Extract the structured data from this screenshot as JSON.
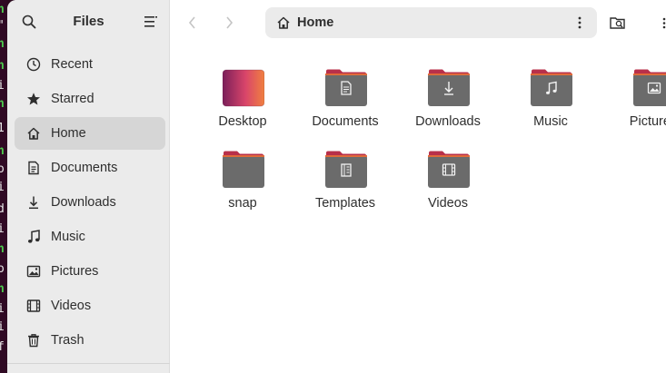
{
  "sidebar": {
    "title": "Files",
    "items": [
      {
        "label": "Recent",
        "icon": "clock-icon"
      },
      {
        "label": "Starred",
        "icon": "star-icon"
      },
      {
        "label": "Home",
        "icon": "home-icon",
        "active": true
      },
      {
        "label": "Documents",
        "icon": "document-icon"
      },
      {
        "label": "Downloads",
        "icon": "download-icon"
      },
      {
        "label": "Music",
        "icon": "music-icon"
      },
      {
        "label": "Pictures",
        "icon": "picture-icon"
      },
      {
        "label": "Videos",
        "icon": "video-icon"
      },
      {
        "label": "Trash",
        "icon": "trash-icon"
      }
    ]
  },
  "pathbar": {
    "label": "Home"
  },
  "folders": [
    {
      "label": "Desktop",
      "emblem": "desktop"
    },
    {
      "label": "Documents",
      "emblem": "document"
    },
    {
      "label": "Downloads",
      "emblem": "download"
    },
    {
      "label": "Music",
      "emblem": "music"
    },
    {
      "label": "Pictures",
      "emblem": "picture"
    },
    {
      "label": "snap",
      "emblem": "none"
    },
    {
      "label": "Templates",
      "emblem": "template"
    },
    {
      "label": "Videos",
      "emblem": "video"
    }
  ],
  "colors": {
    "folder_body": "#6b6b6b",
    "folder_tab": "#c7354a",
    "accent_orange": "#e95420",
    "sidebar_bg": "#ebebeb",
    "active_item": "#d6d6d6"
  }
}
